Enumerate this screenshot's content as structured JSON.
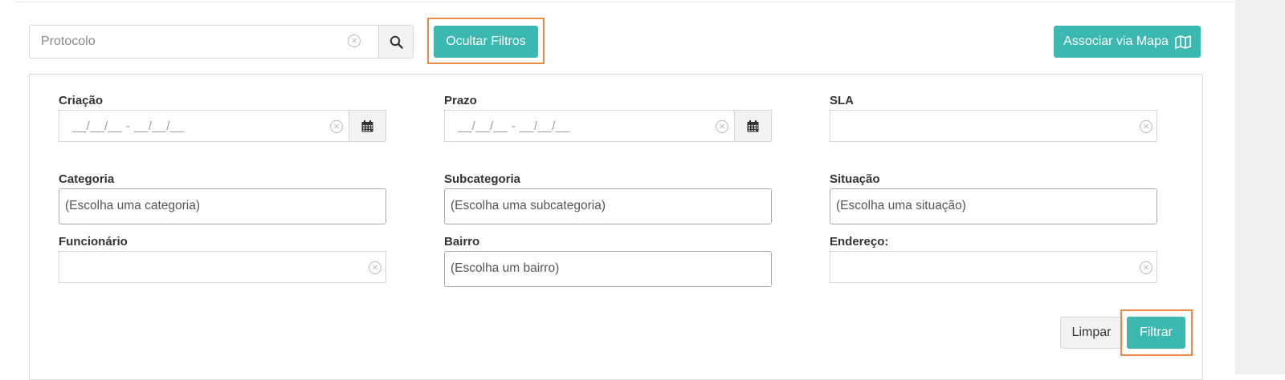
{
  "search": {
    "placeholder": "Protocolo",
    "search_icon": "search-icon",
    "clear_icon": "clear-circle-icon"
  },
  "toolbar": {
    "hide_filters_label": "Ocultar Filtros",
    "map_button_label": "Associar via Mapa",
    "map_icon": "map-icon"
  },
  "filters": {
    "criacao": {
      "label": "Criação",
      "value": "__/__/__ - __/__/__"
    },
    "prazo": {
      "label": "Prazo",
      "value": "__/__/__ - __/__/__"
    },
    "sla": {
      "label": "SLA",
      "value": ""
    },
    "categoria": {
      "label": "Categoria",
      "value": "(Escolha uma categoria)"
    },
    "subcategoria": {
      "label": "Subcategoria",
      "value": "(Escolha uma subcategoria)"
    },
    "situacao": {
      "label": "Situação",
      "value": "(Escolha uma situação)"
    },
    "funcionario": {
      "label": "Funcionário",
      "value": ""
    },
    "bairro": {
      "label": "Bairro",
      "value": "(Escolha um bairro)"
    },
    "endereco": {
      "label": "Endereço:",
      "value": ""
    }
  },
  "actions": {
    "clear_label": "Limpar",
    "filter_label": "Filtrar"
  },
  "colors": {
    "accent": "#3bb8b0",
    "highlight": "#ec8a4a"
  }
}
